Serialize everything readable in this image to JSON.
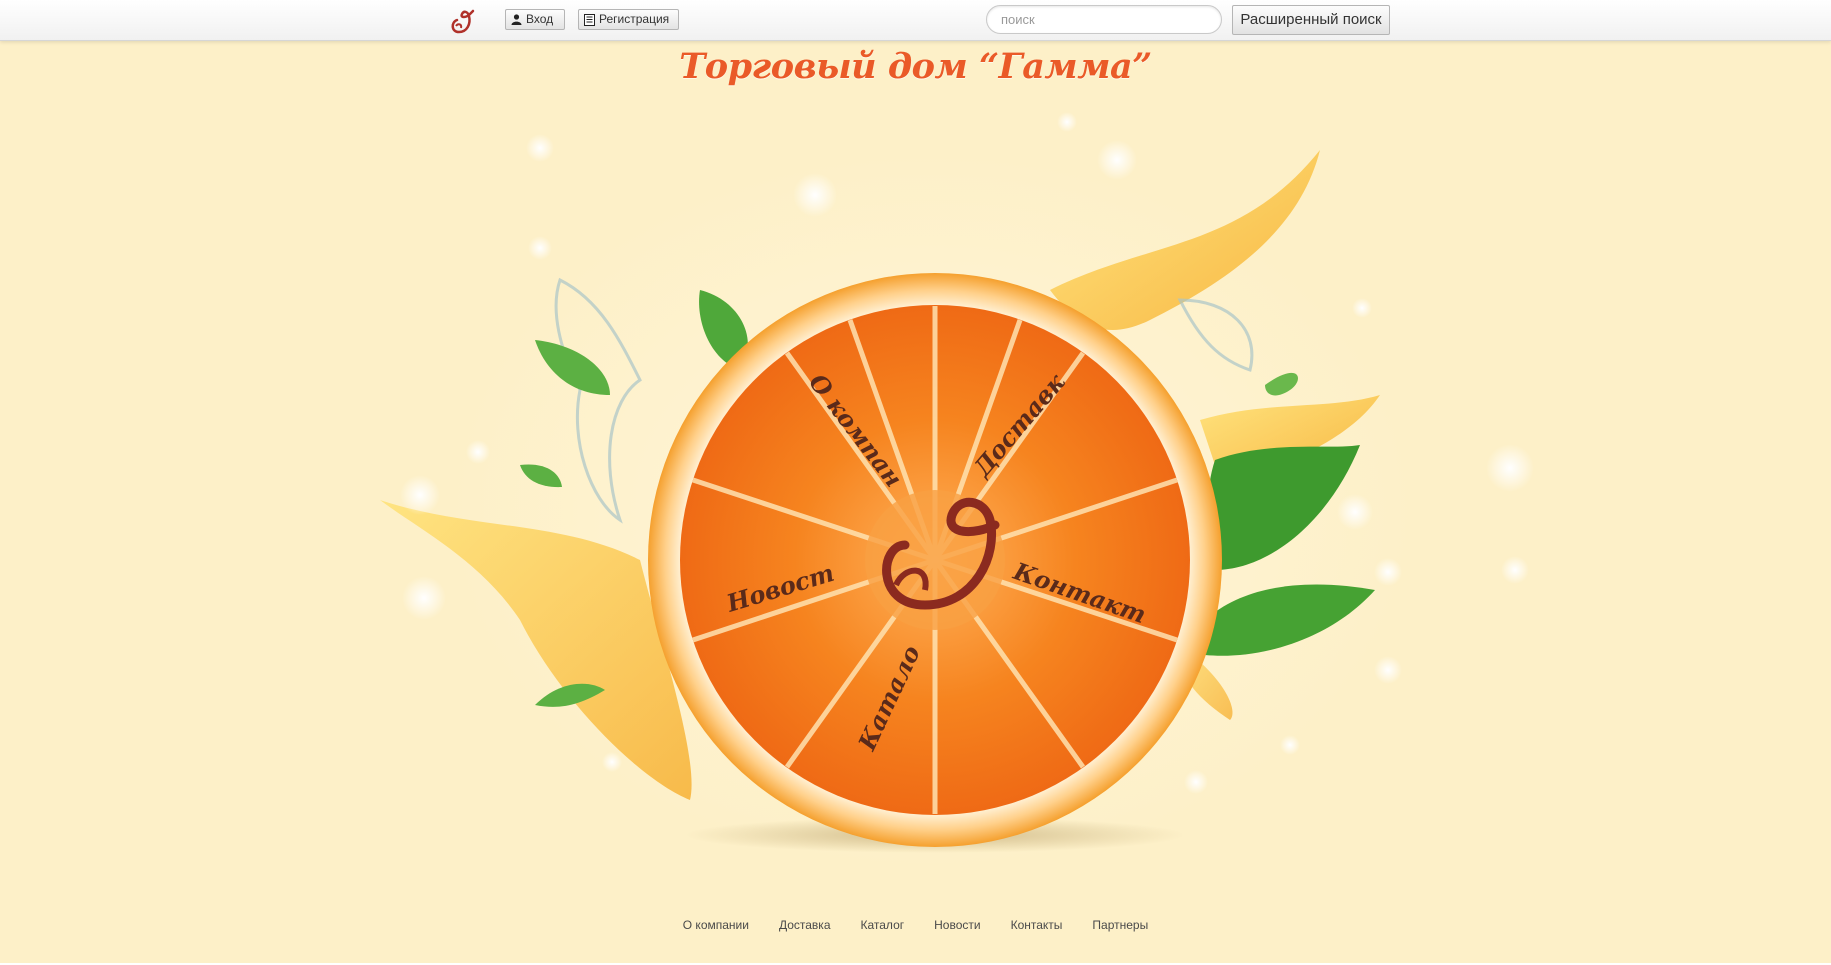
{
  "topbar": {
    "login_label": "Вход",
    "register_label": "Регистрация",
    "search_placeholder": "поиск",
    "advanced_search_label": "Расширенный поиск"
  },
  "site_title": "Торговый дом “Гамма”",
  "orange_menu": {
    "about": "О компании",
    "delivery": "Доставка",
    "news": "Новости",
    "contacts": "Контакты",
    "catalog": "Каталог"
  },
  "footer_nav": [
    "О компании",
    "Доставка",
    "Каталог",
    "Новости",
    "Контакты",
    "Партнеры"
  ],
  "colors": {
    "background": "#fdf0c8",
    "title": "#ea5a28",
    "orange_flesh": "#f47a1c",
    "orange_rind": "#f6a238",
    "menu_text": "#5a2a1a",
    "logo": "#8b2a1f",
    "leaf": "#3e9a2e"
  },
  "icons": [
    "gamma-logo-icon",
    "user-icon",
    "register-form-icon"
  ]
}
